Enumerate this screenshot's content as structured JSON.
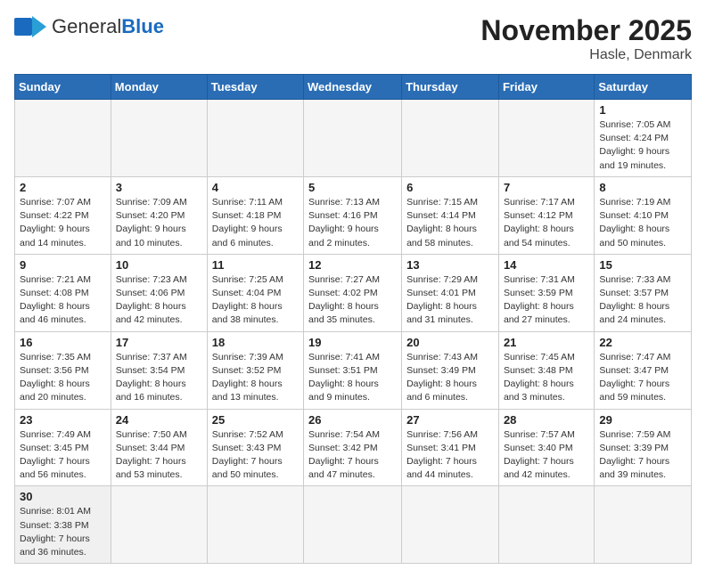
{
  "header": {
    "logo_general": "General",
    "logo_blue": "Blue",
    "month_title": "November 2025",
    "location": "Hasle, Denmark"
  },
  "days_of_week": [
    "Sunday",
    "Monday",
    "Tuesday",
    "Wednesday",
    "Thursday",
    "Friday",
    "Saturday"
  ],
  "weeks": [
    [
      {
        "day": "",
        "info": ""
      },
      {
        "day": "",
        "info": ""
      },
      {
        "day": "",
        "info": ""
      },
      {
        "day": "",
        "info": ""
      },
      {
        "day": "",
        "info": ""
      },
      {
        "day": "",
        "info": ""
      },
      {
        "day": "1",
        "info": "Sunrise: 7:05 AM\nSunset: 4:24 PM\nDaylight: 9 hours and 19 minutes."
      }
    ],
    [
      {
        "day": "2",
        "info": "Sunrise: 7:07 AM\nSunset: 4:22 PM\nDaylight: 9 hours and 14 minutes."
      },
      {
        "day": "3",
        "info": "Sunrise: 7:09 AM\nSunset: 4:20 PM\nDaylight: 9 hours and 10 minutes."
      },
      {
        "day": "4",
        "info": "Sunrise: 7:11 AM\nSunset: 4:18 PM\nDaylight: 9 hours and 6 minutes."
      },
      {
        "day": "5",
        "info": "Sunrise: 7:13 AM\nSunset: 4:16 PM\nDaylight: 9 hours and 2 minutes."
      },
      {
        "day": "6",
        "info": "Sunrise: 7:15 AM\nSunset: 4:14 PM\nDaylight: 8 hours and 58 minutes."
      },
      {
        "day": "7",
        "info": "Sunrise: 7:17 AM\nSunset: 4:12 PM\nDaylight: 8 hours and 54 minutes."
      },
      {
        "day": "8",
        "info": "Sunrise: 7:19 AM\nSunset: 4:10 PM\nDaylight: 8 hours and 50 minutes."
      }
    ],
    [
      {
        "day": "9",
        "info": "Sunrise: 7:21 AM\nSunset: 4:08 PM\nDaylight: 8 hours and 46 minutes."
      },
      {
        "day": "10",
        "info": "Sunrise: 7:23 AM\nSunset: 4:06 PM\nDaylight: 8 hours and 42 minutes."
      },
      {
        "day": "11",
        "info": "Sunrise: 7:25 AM\nSunset: 4:04 PM\nDaylight: 8 hours and 38 minutes."
      },
      {
        "day": "12",
        "info": "Sunrise: 7:27 AM\nSunset: 4:02 PM\nDaylight: 8 hours and 35 minutes."
      },
      {
        "day": "13",
        "info": "Sunrise: 7:29 AM\nSunset: 4:01 PM\nDaylight: 8 hours and 31 minutes."
      },
      {
        "day": "14",
        "info": "Sunrise: 7:31 AM\nSunset: 3:59 PM\nDaylight: 8 hours and 27 minutes."
      },
      {
        "day": "15",
        "info": "Sunrise: 7:33 AM\nSunset: 3:57 PM\nDaylight: 8 hours and 24 minutes."
      }
    ],
    [
      {
        "day": "16",
        "info": "Sunrise: 7:35 AM\nSunset: 3:56 PM\nDaylight: 8 hours and 20 minutes."
      },
      {
        "day": "17",
        "info": "Sunrise: 7:37 AM\nSunset: 3:54 PM\nDaylight: 8 hours and 16 minutes."
      },
      {
        "day": "18",
        "info": "Sunrise: 7:39 AM\nSunset: 3:52 PM\nDaylight: 8 hours and 13 minutes."
      },
      {
        "day": "19",
        "info": "Sunrise: 7:41 AM\nSunset: 3:51 PM\nDaylight: 8 hours and 9 minutes."
      },
      {
        "day": "20",
        "info": "Sunrise: 7:43 AM\nSunset: 3:49 PM\nDaylight: 8 hours and 6 minutes."
      },
      {
        "day": "21",
        "info": "Sunrise: 7:45 AM\nSunset: 3:48 PM\nDaylight: 8 hours and 3 minutes."
      },
      {
        "day": "22",
        "info": "Sunrise: 7:47 AM\nSunset: 3:47 PM\nDaylight: 7 hours and 59 minutes."
      }
    ],
    [
      {
        "day": "23",
        "info": "Sunrise: 7:49 AM\nSunset: 3:45 PM\nDaylight: 7 hours and 56 minutes."
      },
      {
        "day": "24",
        "info": "Sunrise: 7:50 AM\nSunset: 3:44 PM\nDaylight: 7 hours and 53 minutes."
      },
      {
        "day": "25",
        "info": "Sunrise: 7:52 AM\nSunset: 3:43 PM\nDaylight: 7 hours and 50 minutes."
      },
      {
        "day": "26",
        "info": "Sunrise: 7:54 AM\nSunset: 3:42 PM\nDaylight: 7 hours and 47 minutes."
      },
      {
        "day": "27",
        "info": "Sunrise: 7:56 AM\nSunset: 3:41 PM\nDaylight: 7 hours and 44 minutes."
      },
      {
        "day": "28",
        "info": "Sunrise: 7:57 AM\nSunset: 3:40 PM\nDaylight: 7 hours and 42 minutes."
      },
      {
        "day": "29",
        "info": "Sunrise: 7:59 AM\nSunset: 3:39 PM\nDaylight: 7 hours and 39 minutes."
      }
    ],
    [
      {
        "day": "30",
        "info": "Sunrise: 8:01 AM\nSunset: 3:38 PM\nDaylight: 7 hours and 36 minutes."
      },
      {
        "day": "",
        "info": ""
      },
      {
        "day": "",
        "info": ""
      },
      {
        "day": "",
        "info": ""
      },
      {
        "day": "",
        "info": ""
      },
      {
        "day": "",
        "info": ""
      },
      {
        "day": "",
        "info": ""
      }
    ]
  ]
}
